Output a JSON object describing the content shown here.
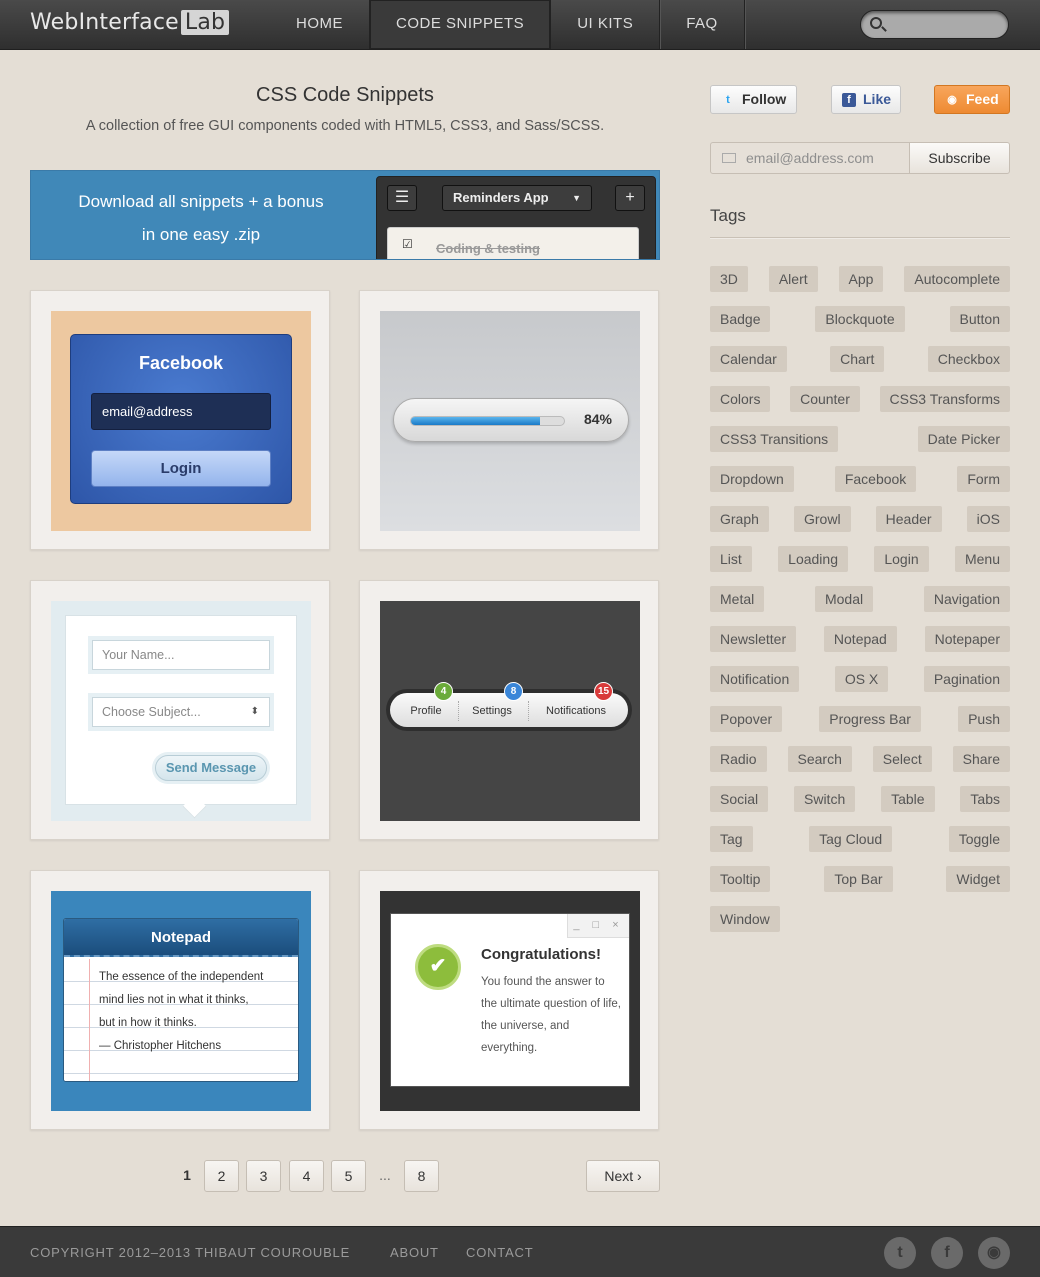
{
  "header": {
    "logo_text": "WebInterface",
    "logo_badge": "Lab",
    "nav": [
      "HOME",
      "CODE SNIPPETS",
      "UI KITS",
      "FAQ"
    ],
    "active_nav": "CODE SNIPPETS"
  },
  "main": {
    "title": "CSS Code Snippets",
    "subtitle": "A collection of free GUI components coded with HTML5, CSS3, and Sass/SCSS.",
    "banner": {
      "line1": "Download all snippets + a bonus",
      "line2": "in one easy .zip",
      "app_title": "Reminders App",
      "menu_glyph": "☰",
      "add_glyph": "+",
      "item": "Coding & testing"
    },
    "cards": {
      "facebook": {
        "title": "Facebook",
        "input_value": "email@address",
        "button": "Login"
      },
      "progress": {
        "value": 0.84,
        "label": "84%"
      },
      "contact": {
        "name_placeholder": "Your Name...",
        "subject_placeholder": "Choose Subject...",
        "send": "Send Message"
      },
      "notif": {
        "items": [
          {
            "label": "Profile",
            "count": "4",
            "color": "#6bab3a"
          },
          {
            "label": "Settings",
            "count": "8",
            "color": "#3a86d8"
          },
          {
            "label": "Notifications",
            "count": "15",
            "color": "#d83a3a"
          }
        ]
      },
      "notepad": {
        "title": "Notepad",
        "lines": [
          "The essence of the independent",
          "mind lies not in what it thinks,",
          "but in how it thinks.",
          "— Christopher Hitchens"
        ]
      },
      "dialog": {
        "controls": "_ □ ×",
        "title": "Congratulations!",
        "text": "You found the answer to the ultimate question of life, the universe, and everything."
      }
    },
    "pagination": {
      "pages": [
        "1",
        "2",
        "3",
        "4",
        "5",
        "...",
        "8"
      ],
      "current": "1",
      "next": "Next ›"
    }
  },
  "sidebar": {
    "follow": "Follow",
    "like": "Like",
    "feed": "Feed",
    "email_placeholder": "email@address.com",
    "subscribe": "Subscribe",
    "tags_title": "Tags",
    "tag_rows": [
      [
        "3D",
        "Alert",
        "App",
        "Autocomplete"
      ],
      [
        "Badge",
        "Blockquote",
        "Button"
      ],
      [
        "Calendar",
        "Chart",
        "Checkbox"
      ],
      [
        "Colors",
        "Counter",
        "CSS3 Transforms"
      ],
      [
        "CSS3 Transitions",
        "Date Picker"
      ],
      [
        "Dropdown",
        "Facebook",
        "Form"
      ],
      [
        "Graph",
        "Growl",
        "Header",
        "iOS"
      ],
      [
        "List",
        "Loading",
        "Login",
        "Menu"
      ],
      [
        "Metal",
        "Modal",
        "Navigation"
      ],
      [
        "Newsletter",
        "Notepad",
        "Notepaper"
      ],
      [
        "Notification",
        "OS X",
        "Pagination"
      ],
      [
        "Popover",
        "Progress Bar",
        "Push"
      ],
      [
        "Radio",
        "Search",
        "Select",
        "Share"
      ],
      [
        "Social",
        "Switch",
        "Table",
        "Tabs"
      ],
      [
        "Tag",
        "Tag Cloud",
        "Toggle"
      ],
      [
        "Tooltip",
        "Top Bar",
        "Widget"
      ],
      [
        "Window"
      ]
    ]
  },
  "footer": {
    "copyright": "COPYRIGHT 2012–2013 THIBAUT COUROUBLE",
    "about": "ABOUT",
    "contact": "CONTACT",
    "icons": [
      "twitter-icon",
      "facebook-icon",
      "rss-icon"
    ]
  }
}
